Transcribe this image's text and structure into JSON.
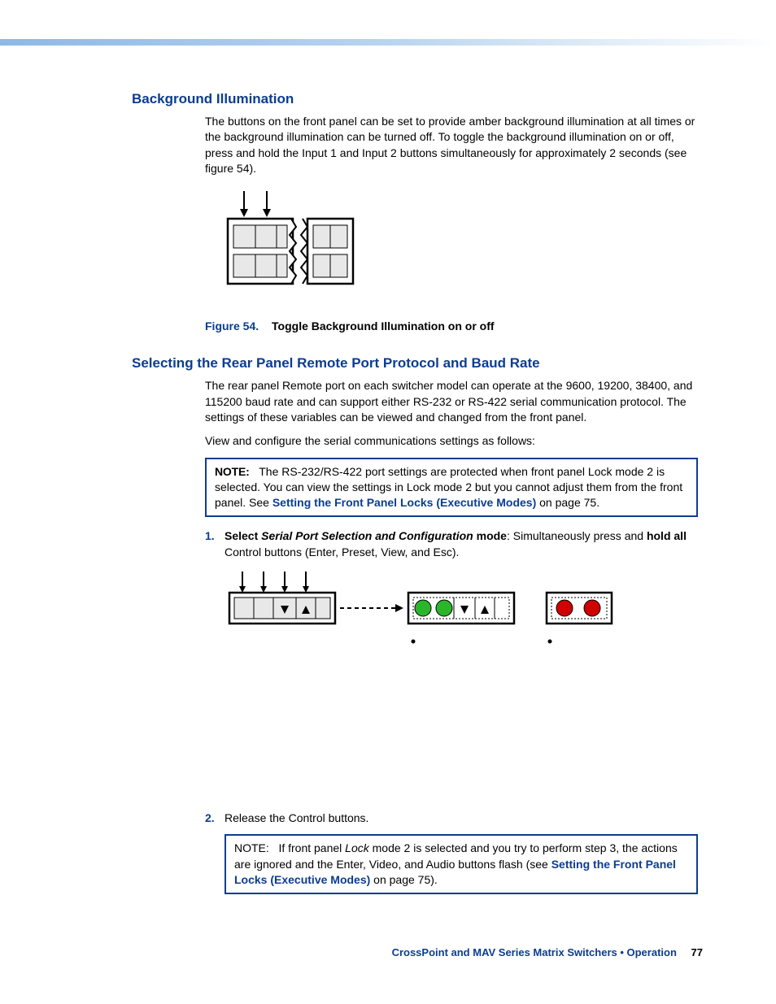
{
  "section1": {
    "heading": "Background Illumination",
    "para": "The buttons on the front panel can be set to provide amber background illumination at all times or the background illumination can be turned off. To toggle the background illumination on or off, press and hold the Input 1 and Input 2 buttons simultaneously for approximately 2 seconds (see figure 54).",
    "figNum": "Figure 54.",
    "figCaption": "Toggle Background Illumination on or off"
  },
  "section2": {
    "heading": "Selecting the Rear Panel Remote Port Protocol and Baud Rate",
    "para1": "The rear panel Remote port on each switcher model can operate at the 9600, 19200, 38400, and 115200 baud rate and can support either RS-232 or RS-422 serial communication protocol. The settings of these variables can be viewed and changed from the front panel.",
    "para2": "View and configure the serial communications settings as follows:",
    "note1_label": "NOTE:",
    "note1_pre": "The RS-232/RS-422 port settings are protected when front panel Lock mode 2 is selected. You can view the settings in Lock mode 2 but you cannot adjust them from the front panel. See ",
    "note1_link": "Setting the Front Panel Locks (Executive Modes)",
    "note1_post": " on page 75.",
    "step1_num": "1.",
    "step1_bold1": "Select ",
    "step1_italic": "Serial Port Selection and Configuration",
    "step1_bold2": " mode",
    "step1_rest": ": Simultaneously press and ",
    "step1_bold3": "hold all",
    "step1_rest2": " Control buttons (Enter, Preset, View, and Esc).",
    "step2_num": "2.",
    "step2_text": "Release the Control buttons.",
    "note2_label": "NOTE:",
    "note2_pre": "If front panel ",
    "note2_italic": "Lock",
    "note2_mid": " mode 2 is selected and you try to perform step 3, the actions are ignored and the Enter, Video, and Audio buttons flash (see ",
    "note2_link": "Setting the Front Panel Locks (Executive Modes)",
    "note2_post": " on page 75)."
  },
  "footer": {
    "title": "CrossPoint and MAV Series Matrix Switchers • Operation",
    "page": "77"
  }
}
